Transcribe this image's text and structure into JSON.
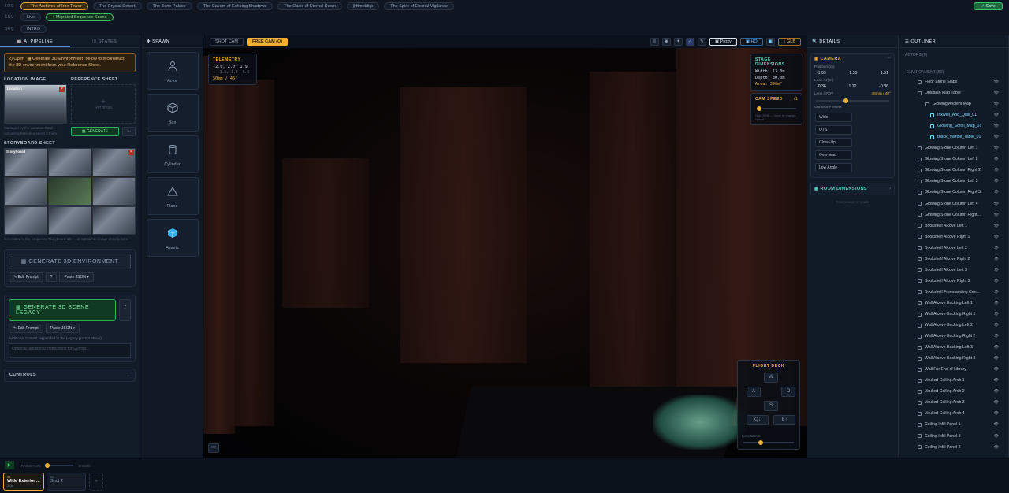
{
  "nav": {
    "loc_label": "LOC",
    "env_label": "ENV",
    "seq_label": "SEQ",
    "locations": [
      "+ The Archives of Iron Tower",
      "The Crystal Desert",
      "The Bone Palace",
      "The Cavern of Echoing Shadows",
      "The Oasis of Eternal Dawn",
      "jkftmnbttfp",
      "The Spire of Eternal Vigilance"
    ],
    "env": [
      "Live",
      "+ Migrated Sequence Scene"
    ],
    "seq": [
      "INTRO"
    ],
    "save_label": "✓ Save"
  },
  "left": {
    "tab_pipeline": "AI PIPELINE",
    "tab_states": "STATES",
    "hint": "2) Open \"▦ Generate 3D Environment\" below to reconstruct the 3D environment from your Reference Sheet.",
    "location_image_title": "LOCATION IMAGE",
    "reference_sheet_title": "REFERENCE SHEET",
    "location_tag": "Location",
    "ref_placeholder": "Ref photo",
    "location_note": "Managed by the Location Card — uploading here also saves it there.",
    "generate_label": "▦ GENERATE",
    "storyboard_title": "STORYBOARD SHEET",
    "storyboard_tag": "Storyboard",
    "storyboard_note": "Generated in the Sequence Storyboard tab — or upload an image directly here.",
    "gen3d_label": "▦ GENERATE 3D ENVIRONMENT",
    "edit_prompt": "✎ Edit Prompt",
    "help": "?",
    "paste_json": "Paste JSON ▾",
    "legacy_label": "▦ GENERATE 3D SCENE LEGACY",
    "legacy_more": "▾",
    "edit_prompt2": "✎ Edit Prompt",
    "paste_json2": "Paste JSON ▾",
    "additional_context": "Additional Context (appended to the Legacy prompt above):",
    "context_placeholder": "Optional: additional instructions for Gemini...",
    "controls_label": "CONTROLS"
  },
  "spawn": {
    "title": "SPAWN",
    "items": [
      "Actor",
      "Box",
      "Cylinder",
      "Plane",
      "Assets"
    ]
  },
  "viewport": {
    "tab_shot": "SHOT CAM",
    "tab_free": "FREE CAM (O)",
    "proxy": "Proxy",
    "hq": "HQ",
    "glb": "GLB",
    "telemetry_title": "TELEMETRY",
    "telemetry_pos": "-2.0, 2.0, 1.9",
    "telemetry_dir": "→ -1.5, 1.4 -0.6",
    "telemetry_lens": "50mm / 45°",
    "stage_title": "STAGE DIMENSIONS",
    "stage_width": "Width: 13.0m",
    "stage_depth": "Depth: 30.0m",
    "stage_area": "Area: 390m²",
    "camspeed_title": "CAM SPEED",
    "camspeed_value": "x1",
    "camspeed_note": "Hold Shift — scroll to change speed",
    "flight_title": "FLIGHT DECK",
    "keys": [
      "W",
      "A",
      "D",
      "S",
      "Q↓",
      "E↑"
    ],
    "lens_label": "Lens 50mm"
  },
  "details": {
    "title": "DETAILS",
    "camera_title": "CAMERA",
    "position_label": "Position (m)",
    "pos": [
      "-1.09",
      "1.55",
      "1.51"
    ],
    "lookat_label": "Look At (m)",
    "look": [
      "-0.36",
      "1.72",
      "-0.36"
    ],
    "lens_label": "Lens / FOV",
    "lens_value": "48mm / 40°",
    "presets_label": "Camera Presets",
    "presets": [
      "Wide",
      "OTS",
      "Close-Up",
      "Overhead",
      "Low Angle"
    ],
    "room_title": "ROOM DIMENSIONS",
    "room_note": "Select room to resize"
  },
  "outliner": {
    "title": "OUTLINER",
    "actors": "ACTORS (0)",
    "env": "ENVIRONMENT (89)",
    "items": [
      {
        "name": "Floor Stone Slabs",
        "lvl": 0
      },
      {
        "name": "Obsidian Map Table",
        "lvl": 0
      },
      {
        "name": "Glowing Ancient Map",
        "lvl": 1
      },
      {
        "name": "Inkwell_And_Quill_01",
        "lvl": 2
      },
      {
        "name": "Glowing_Scroll_Map_01",
        "lvl": 2
      },
      {
        "name": "Black_Marble_Table_01",
        "lvl": 2
      },
      {
        "name": "Glowing Stone Column Left 1",
        "lvl": 0
      },
      {
        "name": "Glowing Stone Column Left 2",
        "lvl": 0
      },
      {
        "name": "Glowing Stone Column Right 2",
        "lvl": 0
      },
      {
        "name": "Glowing Stone Column Left 3",
        "lvl": 0
      },
      {
        "name": "Glowing Stone Column Right 3",
        "lvl": 0
      },
      {
        "name": "Glowing Stone Column Left 4",
        "lvl": 0
      },
      {
        "name": "Glowing Stone Column Right...",
        "lvl": 0
      },
      {
        "name": "Bookshelf Alcove Left 1",
        "lvl": 0
      },
      {
        "name": "Bookshelf Alcove Right 1",
        "lvl": 0
      },
      {
        "name": "Bookshelf Alcove Left 2",
        "lvl": 0
      },
      {
        "name": "Bookshelf Alcove Right 2",
        "lvl": 0
      },
      {
        "name": "Bookshelf Alcove Left 3",
        "lvl": 0
      },
      {
        "name": "Bookshelf Alcove Right 3",
        "lvl": 0
      },
      {
        "name": "Bookshelf Freestanding Cen...",
        "lvl": 0
      },
      {
        "name": "Wall Alcove Backing Left 1",
        "lvl": 0
      },
      {
        "name": "Wall Alcove Backing Right 1",
        "lvl": 0
      },
      {
        "name": "Wall Alcove Backing Left 2",
        "lvl": 0
      },
      {
        "name": "Wall Alcove Backing Right 2",
        "lvl": 0
      },
      {
        "name": "Wall Alcove Backing Left 3",
        "lvl": 0
      },
      {
        "name": "Wall Alcove Backing Right 3",
        "lvl": 0
      },
      {
        "name": "Wall Far End of Library",
        "lvl": 0
      },
      {
        "name": "Vaulted Ceiling Arch 1",
        "lvl": 0
      },
      {
        "name": "Vaulted Ceiling Arch 2",
        "lvl": 0
      },
      {
        "name": "Vaulted Ceiling Arch 3",
        "lvl": 0
      },
      {
        "name": "Vaulted Ceiling Arch 4",
        "lvl": 0
      },
      {
        "name": "Ceiling Infill Panel 1",
        "lvl": 0
      },
      {
        "name": "Ceiling Infill Panel 2",
        "lvl": 0
      },
      {
        "name": "Ceiling Infill Panel 3",
        "lvl": 0
      }
    ]
  },
  "bottom": {
    "transition": "TRANSITION",
    "smooth": "Smooth",
    "shot1_num": "01",
    "shot1_name": "Wide Exterior ...",
    "shot1_dur": "2.0s",
    "shot2_num": "02",
    "shot2_name": "Shot 2",
    "add": "+"
  },
  "colors": {
    "accent": "#f0b030",
    "green": "#3fbf6a",
    "teal": "#5fd1c0",
    "blue": "#4a90e2"
  }
}
